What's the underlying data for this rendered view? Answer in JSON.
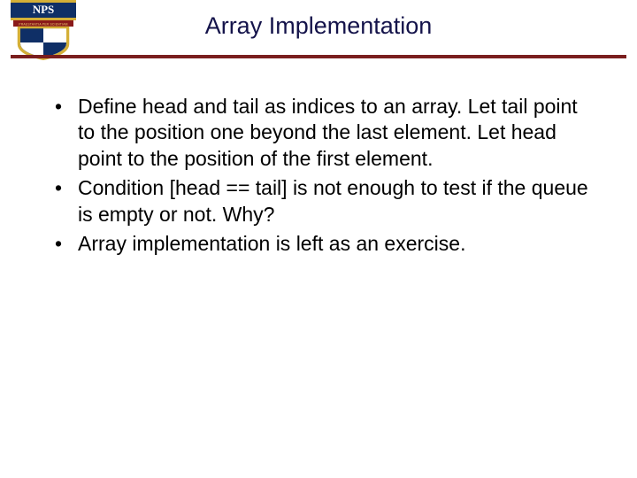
{
  "title": "Array Implementation",
  "logo": {
    "top_text": "NPS",
    "banner_text": "PRAESTANTIA PER SCIENTIAM"
  },
  "bullets": [
    "Define head and tail as indices to an array. Let tail point to the position one beyond the last element. Let head point to the position of the first element.",
    "Condition [head == tail] is not enough to test if the queue is empty or not. Why?",
    "Array implementation is left as an exercise."
  ]
}
